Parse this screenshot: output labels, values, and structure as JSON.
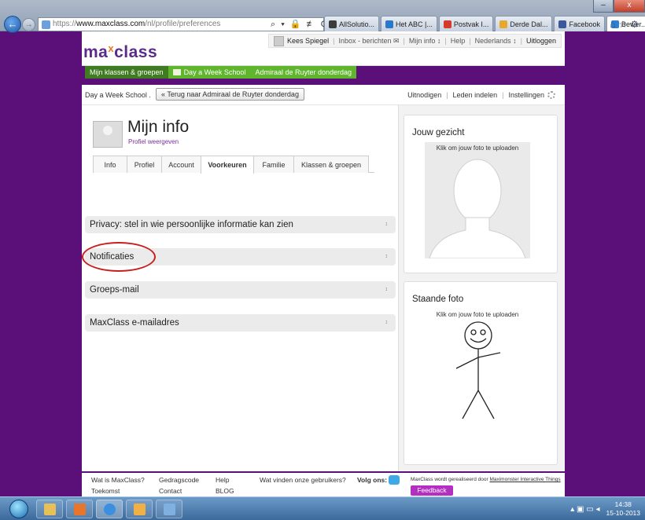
{
  "browser": {
    "url_scheme": "https://",
    "url_host": "www.maxclass.com",
    "url_path": "/nl/profile/preferences",
    "addr_tools": "⌕ ▾ 🔒 ≢ C ✕",
    "tabs": [
      {
        "label": "AllSolutio...",
        "color": "#3b3b3b"
      },
      {
        "label": "Het ABC |...",
        "color": "#2a78c8"
      },
      {
        "label": "Postvak I...",
        "color": "#d33a2c"
      },
      {
        "label": "Derde Dal...",
        "color": "#e8a82e"
      },
      {
        "label": "Facebook",
        "color": "#3b5998"
      },
      {
        "label": "Bewer...",
        "color": "#2f7fd2"
      }
    ],
    "tab_close": "✕",
    "win_min": "–",
    "win_close": "x",
    "chrome_icons": "⌂☆⚙"
  },
  "site": {
    "logo_left": "ma",
    "logo_x": "x",
    "logo_right": "class",
    "topbar": {
      "user": "Kees Spiegel",
      "inbox": "Inbox - berichten ✉",
      "mijn_info": "Mijn info ↕",
      "help": "Help",
      "language": "Nederlands ↕",
      "logout": "Uitloggen"
    },
    "green_nav": [
      "Mijn klassen & groepen",
      "Day a Week School",
      "Admiraal de Ruyter donderdag"
    ],
    "school_crumb": "Day a Week School .",
    "back_button": "« Terug naar Admiraal de Ruyter donderdag",
    "right_actions": [
      "Uitnodigen",
      "Leden indelen",
      "Instellingen"
    ]
  },
  "profile": {
    "title": "Mijn info",
    "view_link": "Profiel weergeven",
    "tabs": [
      "Info",
      "Profiel",
      "Account",
      "Voorkeuren",
      "Familie",
      "Klassen & groepen"
    ],
    "active_tab": "Voorkeuren",
    "sections": [
      "Privacy: stel in wie persoonlijke informatie kan zien",
      "Notificaties",
      "Groeps-mail",
      "MaxClass e-mailadres"
    ],
    "chevron": "↕"
  },
  "sidebar": {
    "face_title": "Jouw gezicht",
    "face_upload": "Klik om jouw foto te uploaden",
    "standing_title": "Staande foto",
    "standing_upload": "Klik om jouw foto te uploaden"
  },
  "footer": {
    "links_col1": [
      "Wat is MaxClass?",
      "Toekomst"
    ],
    "links_col2": [
      "Gedragscode",
      "Contact"
    ],
    "links_col3": [
      "Help",
      "BLOG"
    ],
    "users_link": "Wat vinden onze gebruikers?",
    "follow": "Volg ons:",
    "credit_prefix": "MaxClass wordt gerealiseerd door ",
    "credit_link": "Maximonster Interactive Things",
    "feedback": "Feedback"
  },
  "taskbar": {
    "time": "14:38",
    "date": "15-10-2013",
    "tray_icons": "▴ ▣ ▭ ◂"
  },
  "colors": {
    "background": "#5a1078",
    "brand": "#5b2b8b",
    "green": "#5fb52c",
    "highlight": "#c81e1e",
    "feedback": "#b32fc1"
  }
}
